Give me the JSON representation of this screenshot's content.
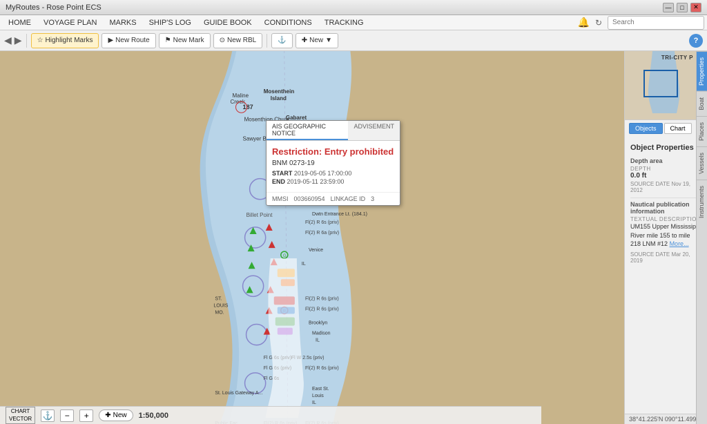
{
  "window": {
    "title": "MyRoutes - Rose Point ECS",
    "controls": [
      "minimize",
      "maximize",
      "close"
    ]
  },
  "menu": {
    "items": [
      {
        "label": "HOME",
        "active": false
      },
      {
        "label": "VOYAGE PLAN",
        "active": false
      },
      {
        "label": "MARKS",
        "active": false
      },
      {
        "label": "SHIP'S LOG",
        "active": false
      },
      {
        "label": "GUIDE BOOK",
        "active": false
      },
      {
        "label": "CONDITIONS",
        "active": false
      },
      {
        "label": "TRACKING",
        "active": false
      }
    ]
  },
  "toolbar": {
    "buttons": [
      {
        "label": "Highlight Marks",
        "icon": "highlight"
      },
      {
        "label": "New Route",
        "icon": "route"
      },
      {
        "label": "New Mark",
        "icon": "mark"
      },
      {
        "label": "New RBL",
        "icon": "rbl"
      },
      {
        "label": "New",
        "icon": "plus",
        "dropdown": true
      }
    ],
    "search_placeholder": "Search"
  },
  "map": {
    "scale": "1:50,000",
    "chart_type": "CHART\nVECTOR",
    "new_button": "New"
  },
  "popup": {
    "tabs": [
      "AIS GEOGRAPHIC NOTICE",
      "ADVISEMENT"
    ],
    "active_tab": "AIS GEOGRAPHIC NOTICE",
    "title": "Restriction: Entry prohibited",
    "id": "BNM 0273-19",
    "start_label": "START",
    "start_value": "2019-05-05 17:00:00",
    "end_label": "END",
    "end_value": "2019-05-11 23:59:00",
    "mmsi_label": "MMSI",
    "mmsi_value": "003660954",
    "linkage_label": "LINKAGE ID",
    "linkage_value": "3"
  },
  "right_panel": {
    "mini_chart_label": "TRI-CITY P",
    "tabs": [
      "Objects",
      "Chart"
    ],
    "active_tab": "Objects",
    "vertical_tabs": [
      "Properties",
      "Boat",
      "Places",
      "Vessels",
      "Instruments"
    ],
    "active_vtab": "Properties",
    "coords": "38°41.225'N 090°11.499'W",
    "object_properties": {
      "title": "Object Properties",
      "sections": [
        {
          "name": "Depth area",
          "depth_label": "DEPTH",
          "depth_value": "0.0 ft",
          "source_label": "SOURCE DATE",
          "source_value": "Nov 19, 2012"
        },
        {
          "name": "Nautical publication information",
          "text_label": "TEXTUAL DESCRIPTION",
          "text_value": "UM155 Upper Mississippi River mile 155 to mile 218 LNM #12",
          "text_link": "More...",
          "source_label": "SOURCE DATE",
          "source_value": "Mar 20, 2019"
        }
      ]
    }
  }
}
